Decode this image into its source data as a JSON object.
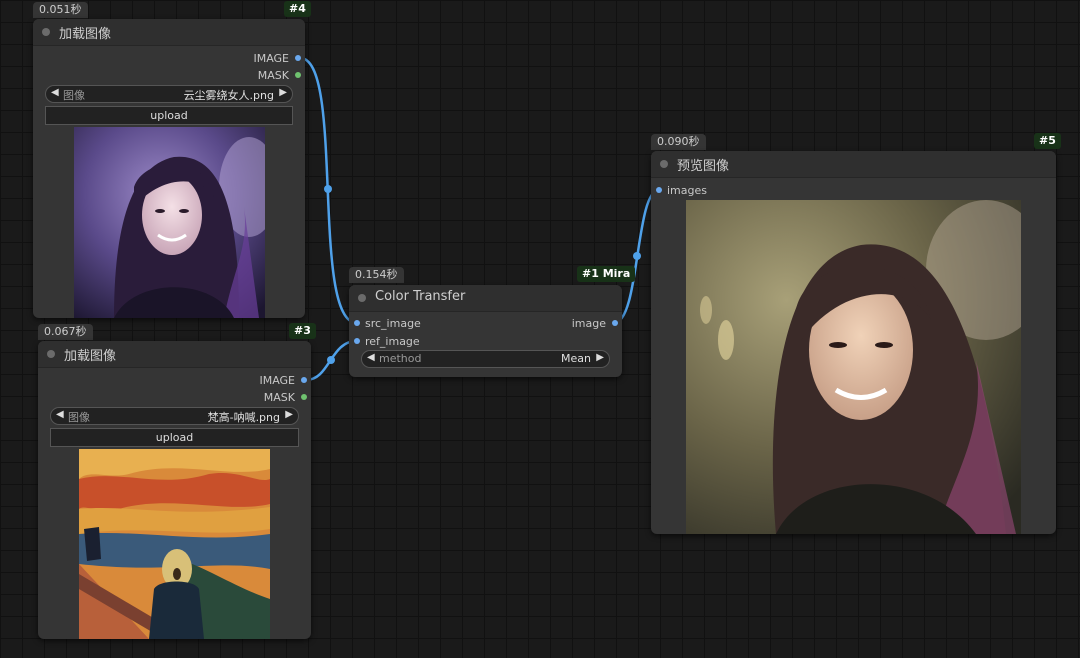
{
  "nodes": {
    "load1": {
      "time": "0.051秒",
      "id_badge": "#4",
      "title": "加载图像",
      "outputs": [
        "IMAGE",
        "MASK"
      ],
      "combo_label": "图像",
      "combo_value": "云尘雾绕女人.png",
      "upload_label": "upload"
    },
    "load2": {
      "time": "0.067秒",
      "id_badge": "#3",
      "title": "加载图像",
      "outputs": [
        "IMAGE",
        "MASK"
      ],
      "combo_label": "图像",
      "combo_value": "梵高-呐喊.png",
      "upload_label": "upload"
    },
    "color_transfer": {
      "time": "0.154秒",
      "id_badge": "#1 Mira",
      "title": "Color Transfer",
      "inputs": [
        "src_image",
        "ref_image"
      ],
      "output": "image",
      "combo_label": "method",
      "combo_value": "Mean"
    },
    "preview": {
      "time": "0.090秒",
      "id_badge": "#5",
      "title": "预览图像",
      "input": "images"
    }
  },
  "colors": {
    "link": "#4fa1ea",
    "socket_image": "#6aa8ee",
    "socket_mask": "#6fc26f",
    "badge_bg": "#183218"
  }
}
